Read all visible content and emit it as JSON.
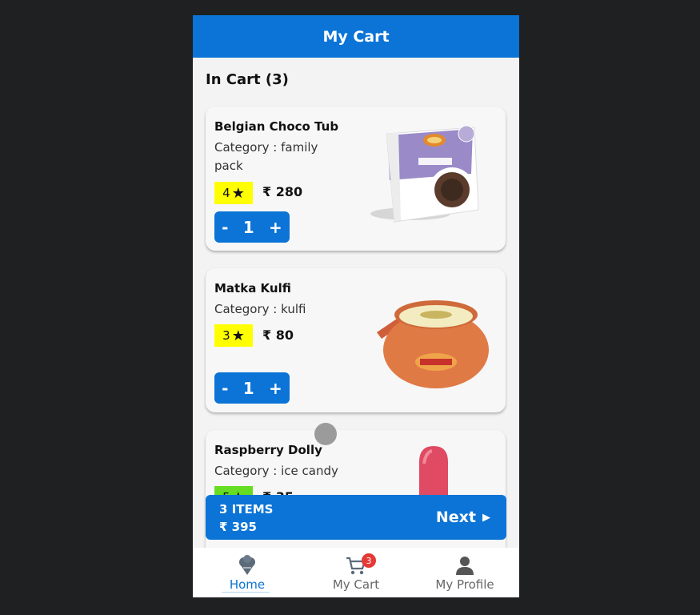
{
  "appbar": {
    "title": "My Cart"
  },
  "section": {
    "title": "In Cart (3)"
  },
  "items": [
    {
      "name": "Belgian Choco Tub",
      "category": "Category : family pack",
      "rating": "4",
      "price": "₹ 280",
      "qty": "1",
      "minus": "-",
      "plus": "+",
      "rating_color": "#ffff00"
    },
    {
      "name": "Matka Kulfi",
      "category": "Category : kulfi",
      "rating": "3",
      "price": "₹ 80",
      "qty": "1",
      "minus": "-",
      "plus": "+",
      "rating_color": "#ffff00"
    },
    {
      "name": "Raspberry Dolly",
      "category": "Category : ice candy",
      "rating": "5",
      "price": "₹ 35",
      "rating_color": "#66dd22"
    }
  ],
  "checkout": {
    "items": "3 ITEMS",
    "total": "₹ 395",
    "next": "Next"
  },
  "nav": {
    "items": [
      {
        "label": "Home",
        "icon": "ice-cream-icon"
      },
      {
        "label": "My Cart",
        "icon": "cart-icon",
        "badge": "3"
      },
      {
        "label": "My Profile",
        "icon": "person-icon"
      }
    ]
  },
  "colors": {
    "primary": "#0b74d6",
    "badge": "#e53935"
  }
}
